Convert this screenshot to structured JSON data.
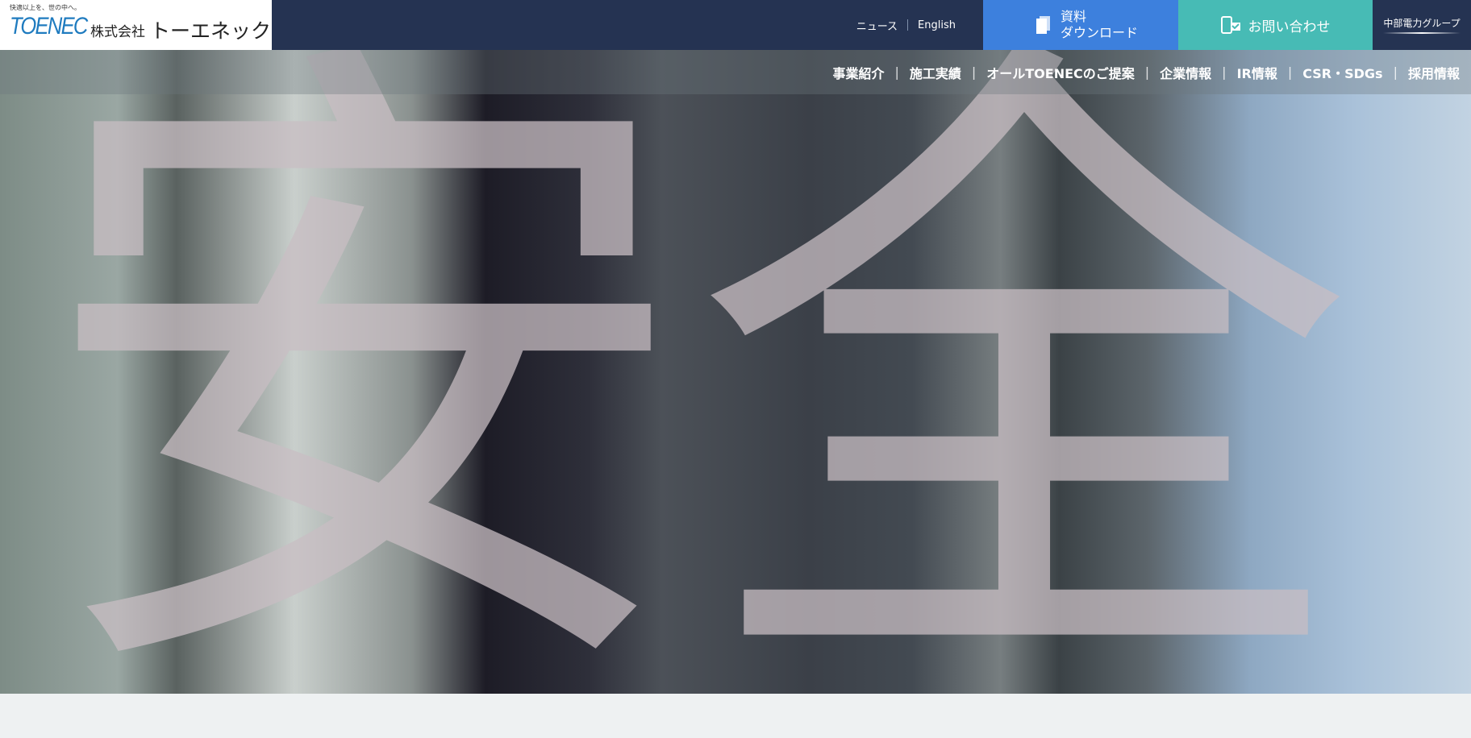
{
  "header": {
    "tagline": "快適以上を、世の中へ。",
    "brand": "TOENEC",
    "company_prefix": "株式会社",
    "company_name": "トーエネック",
    "news": "ニュース",
    "english": "English",
    "doc_button": {
      "line1": "資料",
      "line2": "ダウンロード",
      "icon": "document-icon"
    },
    "contact_button": {
      "label": "お問い合わせ",
      "icon": "phone-mail-icon"
    },
    "group": "中部電力グループ"
  },
  "nav": {
    "items": [
      "事業紹介",
      "施工実績",
      "オールTOENECのご提案",
      "企業情報",
      "IR情報",
      "CSR・SDGs",
      "採用情報"
    ]
  },
  "hero": {
    "text": "安全"
  },
  "colors": {
    "header": "#253352",
    "doc": "#3d80dd",
    "contact": "#47bbb5",
    "brand": "#1f7bbf"
  }
}
